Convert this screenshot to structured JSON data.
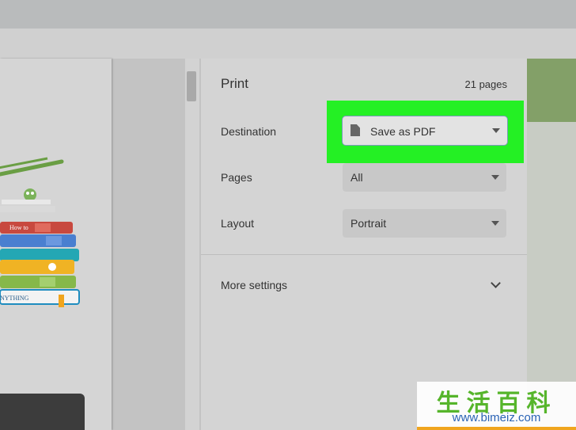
{
  "panel": {
    "title": "Print",
    "page_count": "21 pages",
    "destination": {
      "label": "Destination",
      "value": "Save as PDF"
    },
    "pages": {
      "label": "Pages",
      "value": "All"
    },
    "layout": {
      "label": "Layout",
      "value": "Portrait"
    },
    "more_settings": "More settings"
  },
  "preview": {
    "book_labels": [
      "How to",
      "NYTHING"
    ]
  },
  "watermark": {
    "chars": "生活百科",
    "url": "www.bimeiz.com"
  },
  "colors": {
    "highlight": "#24f024",
    "panel_bg": "#d4d4d4",
    "select_bg": "#c8c8c8"
  }
}
